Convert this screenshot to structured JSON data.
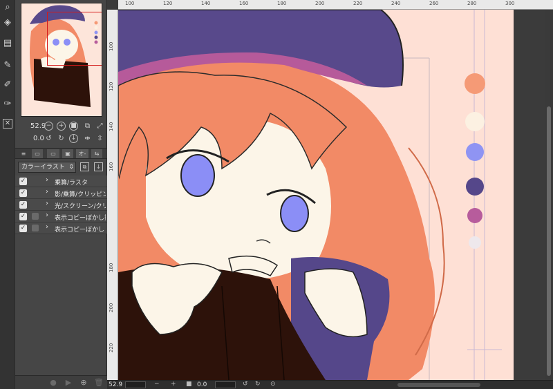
{
  "navigator": {
    "zoom": "52.9",
    "rotation": "0.0"
  },
  "layer_panel": {
    "blend_mode": "カラーイラスト",
    "tab_label": "オ-",
    "layers": [
      {
        "name": "乗算/ラスタ",
        "visible": true
      },
      {
        "name": "影/乗算/クリッピン",
        "visible": true
      },
      {
        "name": "光/スクリーン/クリ",
        "visible": true
      },
      {
        "name": "表示コピーぼかし拡",
        "visible": true
      },
      {
        "name": "表示コピーぼかしレ",
        "visible": true
      }
    ]
  },
  "canvas": {
    "ruler_top": [
      "100",
      "120",
      "140",
      "160",
      "180",
      "200",
      "220",
      "240",
      "260",
      "280",
      "300"
    ],
    "ruler_left": [
      "100",
      "120",
      "140",
      "160",
      "180",
      "200",
      "220"
    ],
    "status_zoom": "52.9",
    "status_rotation": "0.0"
  },
  "palette_swatches": [
    "#f59a76",
    "#fcf1e2",
    "#8f94f3",
    "#55478a",
    "#b75c9c",
    "#eee8ec"
  ],
  "colors": {
    "hair": "#f28a66",
    "hat": "#58498b",
    "skin": "#fcf5e8",
    "eyes": "#8b8ef6",
    "jacket": "#2d120a",
    "background": "#fee0d5",
    "nav_frame": "#d41a1a"
  }
}
